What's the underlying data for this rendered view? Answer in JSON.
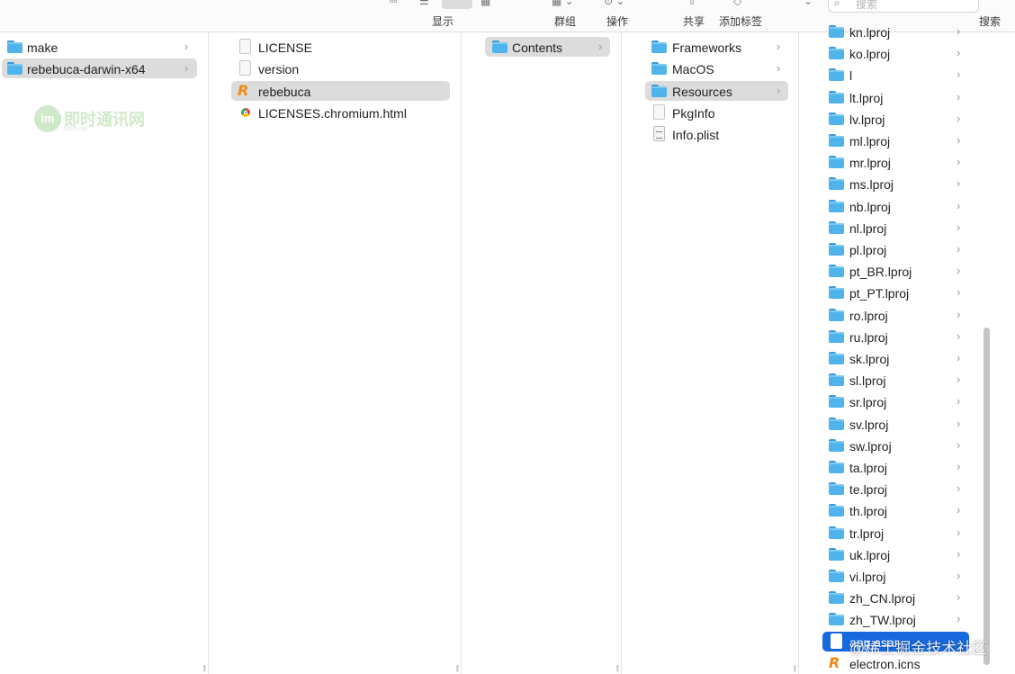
{
  "toolbar": {
    "view_label": "显示",
    "group_label": "群组",
    "action_label": "操作",
    "share_label": "共享",
    "tag_label": "添加标签",
    "search_label": "搜索",
    "search_placeholder": "搜索"
  },
  "col1": {
    "items": [
      {
        "label": "make",
        "icon": "folder-icon"
      },
      {
        "label": "rebebuca-darwin-x64",
        "icon": "folder-icon"
      }
    ],
    "watermark_text": "即时通讯网",
    "watermark_sub": "52im.net"
  },
  "col2": {
    "items": [
      {
        "label": "LICENSE",
        "icon": "document-icon"
      },
      {
        "label": "version",
        "icon": "document-icon"
      },
      {
        "label": "rebebuca",
        "icon": "app-icon"
      },
      {
        "label": "LICENSES.chromium.html",
        "icon": "chrome-icon"
      }
    ]
  },
  "col3": {
    "items": [
      {
        "label": "Contents",
        "icon": "folder-icon"
      }
    ]
  },
  "col4": {
    "items": [
      {
        "label": "Frameworks",
        "icon": "folder-icon"
      },
      {
        "label": "MacOS",
        "icon": "folder-icon"
      },
      {
        "label": "Resources",
        "icon": "folder-icon"
      },
      {
        "label": "PkgInfo",
        "icon": "document-icon"
      },
      {
        "label": "Info.plist",
        "icon": "plist-icon"
      }
    ]
  },
  "col5": {
    "items": [
      {
        "label": "kn.lproj"
      },
      {
        "label": "ko.lproj"
      },
      {
        "label": "l"
      },
      {
        "label": "lt.lproj"
      },
      {
        "label": "lv.lproj"
      },
      {
        "label": "ml.lproj"
      },
      {
        "label": "mr.lproj"
      },
      {
        "label": "ms.lproj"
      },
      {
        "label": "nb.lproj"
      },
      {
        "label": "nl.lproj"
      },
      {
        "label": "pl.lproj"
      },
      {
        "label": "pt_BR.lproj"
      },
      {
        "label": "pt_PT.lproj"
      },
      {
        "label": "ro.lproj"
      },
      {
        "label": "ru.lproj"
      },
      {
        "label": "sk.lproj"
      },
      {
        "label": "sl.lproj"
      },
      {
        "label": "sr.lproj"
      },
      {
        "label": "sv.lproj"
      },
      {
        "label": "sw.lproj"
      },
      {
        "label": "ta.lproj"
      },
      {
        "label": "te.lproj"
      },
      {
        "label": "th.lproj"
      },
      {
        "label": "tr.lproj"
      },
      {
        "label": "uk.lproj"
      },
      {
        "label": "vi.lproj"
      },
      {
        "label": "zh_CN.lproj"
      },
      {
        "label": "zh_TW.lproj"
      },
      {
        "label": "app.asar"
      },
      {
        "label": "electron.icns"
      }
    ],
    "juejin_watermark": "@稀土掘金技术社区"
  },
  "colors": {
    "selected_blue": "#1769e0",
    "selected_gray": "#dcdcdc",
    "folder_blue": "#4fb3ec",
    "app_orange": "#f08a16"
  }
}
